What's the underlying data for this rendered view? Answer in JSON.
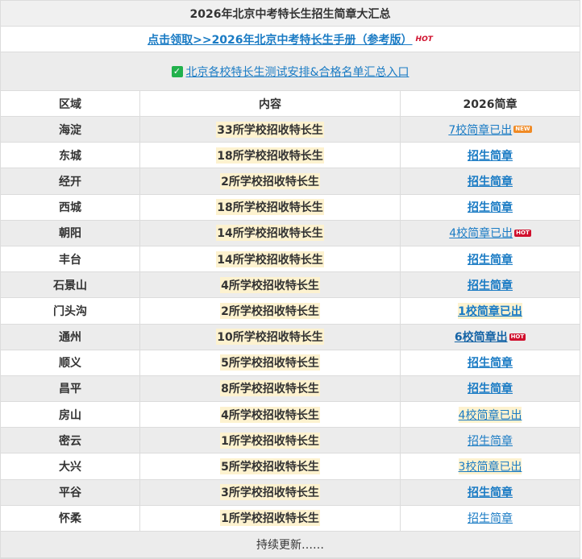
{
  "title": "2026年北京中考特长生招生简章大汇总",
  "handbook": {
    "label": "点击领取>>2026年北京中考特长生手册（参考版）",
    "hot": "HOT"
  },
  "entry": {
    "label": "北京各校特长生测试安排&合格名单汇总入口"
  },
  "headers": {
    "region": "区域",
    "content": "内容",
    "brochure": "2026简章"
  },
  "rows": [
    {
      "region": "海淀",
      "content": "33所学校招收特长生",
      "brochure": "7校简章已出",
      "badge": "NEW"
    },
    {
      "region": "东城",
      "content": "18所学校招收特长生",
      "brochure": "招生简章",
      "badge": ""
    },
    {
      "region": "经开",
      "content": "2所学校招收特长生",
      "brochure": "招生简章",
      "badge": ""
    },
    {
      "region": "西城",
      "content": "18所学校招收特长生",
      "brochure": "招生简章",
      "badge": ""
    },
    {
      "region": "朝阳",
      "content": "14所学校招收特长生",
      "brochure": "4校简章已出",
      "badge": "HOT"
    },
    {
      "region": "丰台",
      "content": "14所学校招收特长生",
      "brochure": "招生简章",
      "badge": ""
    },
    {
      "region": "石景山",
      "content": "4所学校招收特长生",
      "brochure": "招生简章",
      "badge": ""
    },
    {
      "region": "门头沟",
      "content": "2所学校招收特长生",
      "brochure": "1校简章已出",
      "badge": ""
    },
    {
      "region": "通州",
      "content": "10所学校招收特长生",
      "brochure": "6校简章出",
      "badge": "HOT"
    },
    {
      "region": "顺义",
      "content": "5所学校招收特长生",
      "brochure": "招生简章",
      "badge": ""
    },
    {
      "region": "昌平",
      "content": "8所学校招收特长生",
      "brochure": "招生简章",
      "badge": ""
    },
    {
      "region": "房山",
      "content": "4所学校招收特长生",
      "brochure": "4校简章已出",
      "badge": ""
    },
    {
      "region": "密云",
      "content": "1所学校招收特长生",
      "brochure": "招生简章",
      "badge": ""
    },
    {
      "region": "大兴",
      "content": "5所学校招收特长生",
      "brochure": "3校简章已出",
      "badge": ""
    },
    {
      "region": "平谷",
      "content": "3所学校招收特长生",
      "brochure": "招生简章",
      "badge": ""
    },
    {
      "region": "怀柔",
      "content": "1所学校招收特长生",
      "brochure": "招生简章",
      "badge": ""
    }
  ],
  "footer": "持续更新……",
  "colors": {
    "link": "#1a7bc4",
    "highlight": "#fdf2cf",
    "hot": "#d0102d",
    "new": "#f08a24",
    "stripe": "#ececec"
  },
  "icons": {
    "entry": "check-square-icon"
  }
}
